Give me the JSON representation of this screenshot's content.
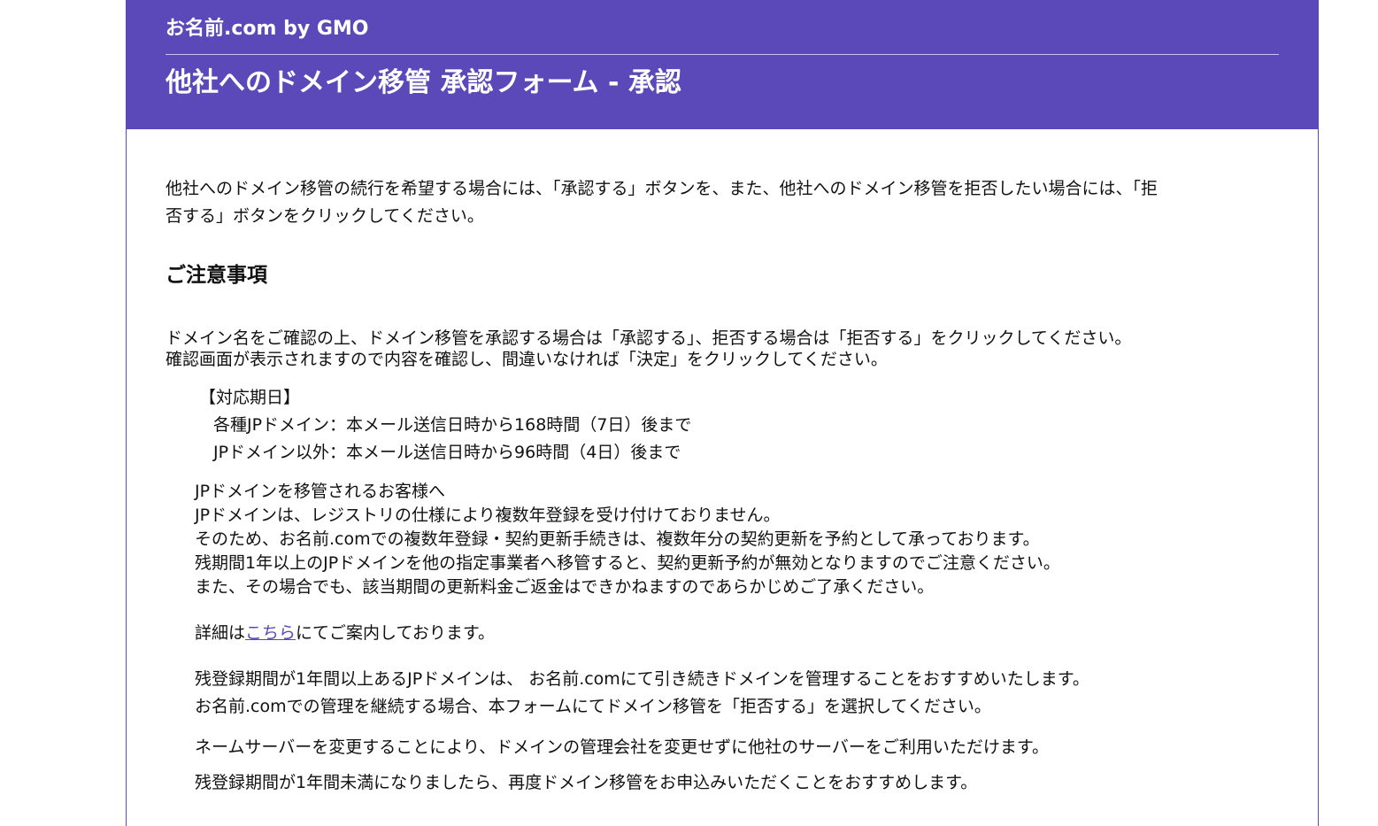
{
  "header": {
    "brand": "お名前.com by GMO",
    "title": "他社へのドメイン移管 承認フォーム - 承認"
  },
  "intro": {
    "line1": "他社へのドメイン移管の続行を希望する場合には、「承認する」ボタンを、また、他社へのドメイン移管を拒否したい場合には、「拒",
    "line2": "否する」ボタンをクリックしてください。"
  },
  "notes": {
    "heading": "ご注意事項",
    "line1": "ドメイン名をご確認の上、ドメイン移管を承認する場合は「承認する」、拒否する場合は「拒否する」をクリックしてください。",
    "line2": "確認画面が表示されますので内容を確認し、間違いなければ「決定」をクリックしてください。"
  },
  "deadline": {
    "heading": "【対応期日】",
    "rows": [
      "各種JPドメイン：本メール送信日時から168時間（7日）後まで",
      "JPドメイン以外：本メール送信日時から96時間（4日）後まで"
    ]
  },
  "jp_notice": {
    "lines": [
      "JPドメインを移管されるお客様へ",
      "JPドメインは、レジストリの仕様により複数年登録を受け付けておりません。",
      "そのため、お名前.comでの複数年登録・契約更新手続きは、複数年分の契約更新を予約として承っております。",
      "残期間1年以上のJPドメインを他の指定事業者へ移管すると、契約更新予約が無効となりますのでご注意ください。",
      "また、その場合でも、該当期間の更新料金ご返金はできかねますのであらかじめご了承ください。"
    ]
  },
  "detail": {
    "prefix": "詳細は",
    "link": "こちら",
    "suffix": "にてご案内しております。"
  },
  "remain": {
    "line1": "残登録期間が1年間以上あるJPドメインは、 お名前.comにて引き続きドメインを管理することをおすすめいたします。",
    "line2": "お名前.comでの管理を継続する場合、本フォームにてドメイン移管を「拒否する」を選択してください。"
  },
  "nameserver": "ネームサーバーを変更することにより、ドメインの管理会社を変更せずに他社のサーバーをご利用いただけます。",
  "recommend": "残登録期間が1年間未満になりましたら、再度ドメイン移管をお申込みいただくことをおすすめします。",
  "colors": {
    "header_bg": "#5b49b9",
    "link": "#5b49b9"
  }
}
